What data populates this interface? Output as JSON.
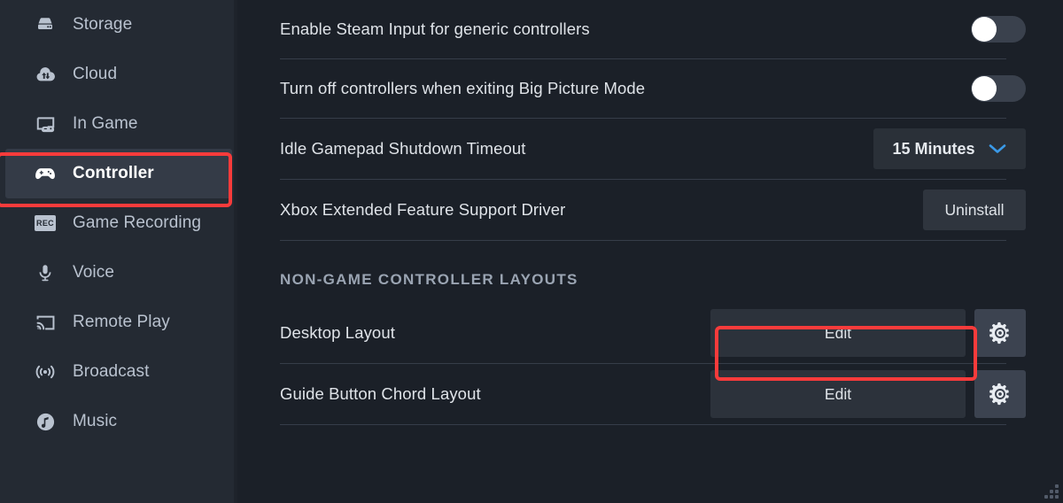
{
  "sidebar": {
    "items": [
      {
        "label": "Storage",
        "icon": "storage-icon",
        "active": false
      },
      {
        "label": "Cloud",
        "icon": "cloud-sync-icon",
        "active": false
      },
      {
        "label": "In Game",
        "icon": "in-game-icon",
        "active": false
      },
      {
        "label": "Controller",
        "icon": "gamepad-icon",
        "active": true
      },
      {
        "label": "Game Recording",
        "icon": "rec-badge-icon",
        "active": false
      },
      {
        "label": "Voice",
        "icon": "microphone-icon",
        "active": false
      },
      {
        "label": "Remote Play",
        "icon": "remote-play-icon",
        "active": false
      },
      {
        "label": "Broadcast",
        "icon": "broadcast-icon",
        "active": false
      },
      {
        "label": "Music",
        "icon": "music-note-icon",
        "active": false
      }
    ]
  },
  "main": {
    "rows": [
      {
        "label": "Enable Steam Input for generic controllers",
        "control": "toggle",
        "state": "off"
      },
      {
        "label": "Turn off controllers when exiting Big Picture Mode",
        "control": "toggle",
        "state": "off"
      },
      {
        "label": "Idle Gamepad Shutdown Timeout",
        "control": "dropdown",
        "value": "15 Minutes"
      },
      {
        "label": "Xbox Extended Feature Support Driver",
        "control": "button",
        "button_label": "Uninstall"
      }
    ],
    "section_header": "NON-GAME CONTROLLER LAYOUTS",
    "layout_rows": [
      {
        "label": "Desktop Layout",
        "button_label": "Edit",
        "gear": "gear-icon",
        "highlighted": true
      },
      {
        "label": "Guide Button Chord Layout",
        "button_label": "Edit",
        "gear": "gear-icon",
        "highlighted": false
      }
    ]
  },
  "colors": {
    "highlight": "#f93b3b",
    "accent_blue": "#3a9ae8",
    "sidebar_bg": "#242a33",
    "main_bg": "#1b2028",
    "active_item_bg": "#343b47"
  }
}
